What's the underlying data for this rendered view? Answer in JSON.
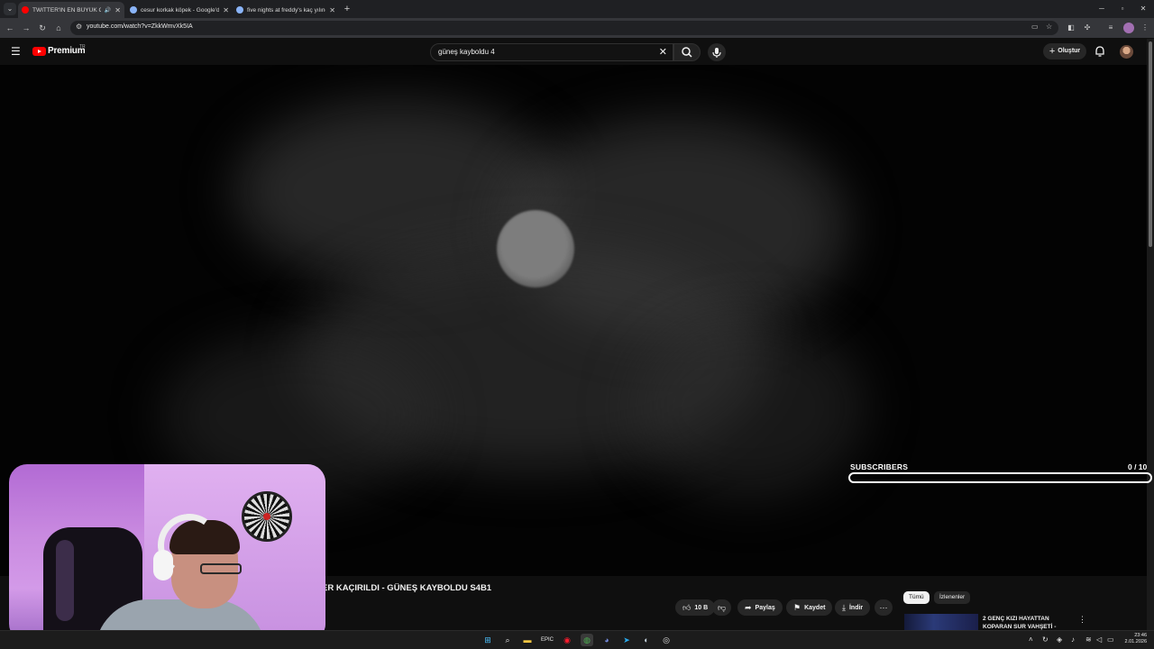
{
  "browser": {
    "tabs": [
      {
        "title": "TWITTER'IN EN BÜYÜK GİZ",
        "active": true,
        "favicon_color": "#ff0000",
        "audio": true
      },
      {
        "title": "cesur korkak köpek - Google'd",
        "active": false,
        "favicon_color": "#8ab4f8"
      },
      {
        "title": "five nights at freddy's kaç yılınd",
        "active": false,
        "favicon_color": "#8ab4f8"
      }
    ],
    "url": "youtube.com/watch?v=ZkkWmvXk5IA"
  },
  "youtube": {
    "brand": "Premium",
    "country": "TR",
    "search_value": "güneş kayboldu 4",
    "create_label": "Oluştur"
  },
  "overlay": {
    "subscribers_label": "SUBSCRIBERS",
    "subscribers_count": "0  / 10",
    "subscribers_progress": 0
  },
  "video": {
    "title_visible": "ER KAÇIRILDI - GÜNEŞ KAYBOLDU S4B1",
    "actions": {
      "likes": "10 B",
      "share": "Paylaş",
      "save": "Kaydet",
      "download": "İndir"
    }
  },
  "sidebar": {
    "chips": [
      "Tümü",
      "İzlenenler"
    ],
    "recommendation_title": "2 GENÇ KIZI HAYATTAN KOPARAN SUR VAHŞETİ -"
  },
  "taskbar": {
    "time": "23:46",
    "date": "2.01.2026"
  },
  "colors": {
    "youtube_red": "#ff0000",
    "background": "#0f0f0f",
    "chip_selected": "#f1f1f1"
  }
}
